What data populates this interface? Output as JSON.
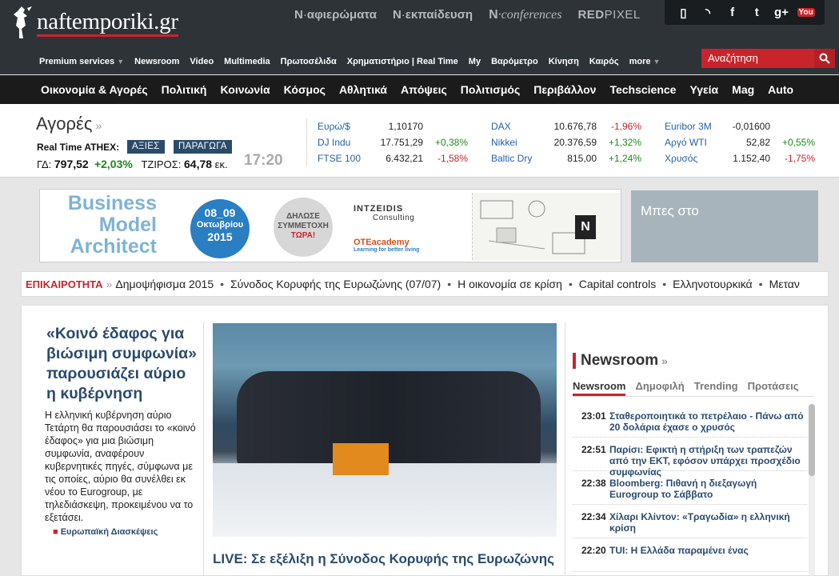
{
  "header": {
    "logo": "naftemporiki.gr",
    "brands": [
      {
        "prefix": "N",
        "name": "αφιερώματα"
      },
      {
        "prefix": "N",
        "name": "εκπαίδευση"
      },
      {
        "prefix": "N",
        "name": "conferences"
      }
    ],
    "redpixel": {
      "a": "RED",
      "b": "PIXEL"
    },
    "social": [
      "mobile-icon",
      "rss-icon",
      "facebook-icon",
      "twitter-icon",
      "googleplus-icon",
      "youtube-icon"
    ],
    "social_glyphs": [
      "▯",
      "◝",
      "f",
      "t",
      "g+",
      "You"
    ],
    "nav": [
      "Premium services",
      "Newsroom",
      "Video",
      "Multimedia",
      "Πρωτοσέλιδα",
      "Χρηματιστήριο | Real Time",
      "My",
      "Βαρόμετρο",
      "Κίνηση",
      "Καιρός",
      "more"
    ],
    "search_placeholder": "Αναζήτηση"
  },
  "categories": [
    "Οικονομία & Αγορές",
    "Πολιτική",
    "Κοινωνία",
    "Κόσμος",
    "Αθλητικά",
    "Απόψεις",
    "Πολιτισμός",
    "Περιβάλλον",
    "Techscience",
    "Υγεία",
    "Mag",
    "Auto"
  ],
  "markets": {
    "title": "Αγορές",
    "realtime_label": "Real Time ATHEX:",
    "btn_stocks": "ΑΞΙΕΣ",
    "btn_derivatives": "ΠΑΡΑΓΩΓΑ",
    "gd_label": "ΓΔ:",
    "gd_value": "797,52",
    "gd_change": "+2,03%",
    "turnover_label": "ΤΖΙΡΟΣ:",
    "turnover_value": "64,78",
    "turnover_unit": "εκ.",
    "time": "17:20",
    "columns": [
      [
        {
          "name": "Ευρώ/$",
          "value": "1,10170",
          "change": ""
        },
        {
          "name": "DJ Indu",
          "value": "17.751,29",
          "change": "+0,38%"
        },
        {
          "name": "FTSE 100",
          "value": "6.432,21",
          "change": "-1,58%"
        }
      ],
      [
        {
          "name": "DAX",
          "value": "10.676,78",
          "change": "-1,96%"
        },
        {
          "name": "Nikkei",
          "value": "20.376,59",
          "change": "+1,32%"
        },
        {
          "name": "Baltic Dry",
          "value": "815,00",
          "change": "+1,24%"
        }
      ],
      [
        {
          "name": "Euribor 3M",
          "value": "-0,01600",
          "change": ""
        },
        {
          "name": "Αργό WTI",
          "value": "52,82",
          "change": "+0,55%"
        },
        {
          "name": "Χρυσός",
          "value": "1.152,40",
          "change": "-1,75%"
        }
      ]
    ]
  },
  "banner": {
    "title_lines": [
      "Business",
      "Model",
      "Architect"
    ],
    "date": "08_09",
    "month": "Οκτωβρίου",
    "year": "2015",
    "cta_lines": [
      "ΔΗΛΩΣΕ",
      "ΣΥΜΜΕΤΟΧΗ",
      "ΤΩΡΑ!"
    ],
    "sponsor1": "INTZEIDIS",
    "sponsor1_sub": "Consulting",
    "sponsor2": "OTEacademy",
    "sponsor2_sub": "Learning for better living",
    "sketch_letter": "N"
  },
  "ad2": "Μπες στο",
  "trending": {
    "label": "ΕΠΙΚΑΙΡΟΤΗΤΑ",
    "items": [
      "Δημοψήφισμα 2015",
      "Σύνοδος Κορυφής της Ευρωζώνης (07/07)",
      "Η οικονομία σε κρίση",
      "Capital controls",
      "Ελληνοτουρκικά",
      "Μεταν"
    ]
  },
  "lead": {
    "headline": "«Κοινό έδαφος για βιώσιμη συμφωνία» παρουσιάζει αύριο η κυβέρνηση",
    "body": "Η ελληνική κυβέρνηση αύριο Τετάρτη θα παρουσιάσει το «κοινό έδαφος» για μια βιώσιμη συμφωνία, αναφέρουν κυβερνητικές πηγές, σύμφωνα με τις οποίες, αύριο θα συνέλθει εκ νέου το Eurogroup, με τηλεδιάσκεψη, προκειμένου να το εξετάσει.",
    "related": "Ευρωπαϊκή Διασκέψεις"
  },
  "photo_caption": "LIVE: Σε εξέλιξη η Σύνοδος Κορυφής της Ευρωζώνης",
  "newsroom": {
    "title": "Newsroom",
    "tabs": [
      "Newsroom",
      "Δημοφιλή",
      "Trending",
      "Προτάσεις"
    ],
    "items": [
      {
        "time": "23:01",
        "text": "Σταθεροποιητικά το πετρέλαιο - Πάνω από 20 δολάρια έχασε ο χρυσός"
      },
      {
        "time": "22:51",
        "text": "Παρίσι: Εφικτή η στήριξη των τραπεζών από την ΕΚΤ, εφόσον υπάρχει προσχέδιο συμφωνίας"
      },
      {
        "time": "22:38",
        "text": "Bloomberg: Πιθανή η διεξαγωγή Eurogroup το Σάββατο"
      },
      {
        "time": "22:34",
        "text": "Χίλαρι Κλίντον: «Τραγωδία» η ελληνική κρίση"
      },
      {
        "time": "22:20",
        "text": "TUI: Η Ελλάδα παραμένει ένας"
      }
    ]
  }
}
